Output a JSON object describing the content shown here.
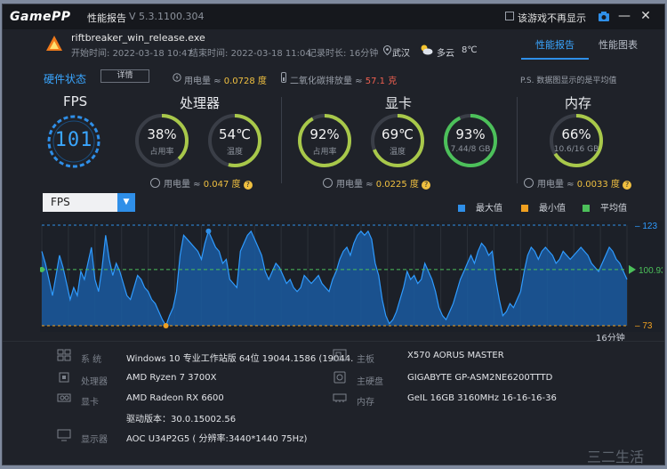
{
  "app": {
    "logo": "GamePP",
    "title": "性能报告",
    "version": "V 5.3.1100.304"
  },
  "titlebar": {
    "checkbox_label": "该游戏不再显示",
    "camera_icon": "camera-icon",
    "minimize": "—",
    "close": "✕"
  },
  "game": {
    "name": "riftbreaker_win_release.exe",
    "start_label": "开始时间:",
    "start_time": "2022-03-18 10:47",
    "end_label": "结束时间:",
    "end_time": "2022-03-18 11:04",
    "duration_label": "记录时长:",
    "duration": "16分钟",
    "city": "武汉",
    "weather": "多云",
    "temperature": "8℃"
  },
  "tabs": [
    {
      "label": "性能报告",
      "active": true
    },
    {
      "label": "性能图表",
      "active": false
    }
  ],
  "summary": {
    "hw_status": "硬件状态",
    "detail_btn": "详情",
    "power_label": "用电量 ≈",
    "power_value": "0.0728 度",
    "co2_label": "二氧化碳排放量 ≈",
    "co2_value": "57.1 克",
    "note": "P.S. 数据图显示的是平均值"
  },
  "sections": {
    "fps": "FPS",
    "cpu": "处理器",
    "gpu": "显卡",
    "mem": "内存"
  },
  "gauges": {
    "fps": {
      "value": "101"
    },
    "cpu_usage": {
      "value": "38%",
      "label": "占用率",
      "fraction": 0.38,
      "color": "#a8c84a"
    },
    "cpu_temp": {
      "value": "54℃",
      "label": "温度",
      "fraction": 0.54,
      "color": "#a8c84a"
    },
    "gpu_usage": {
      "value": "92%",
      "label": "占用率",
      "fraction": 0.92,
      "color": "#a8c84a"
    },
    "gpu_temp": {
      "value": "69℃",
      "label": "温度",
      "fraction": 0.69,
      "color": "#a8c84a"
    },
    "gpu_mem": {
      "value": "93%",
      "label": "7.44/8 GB",
      "fraction": 0.93,
      "color": "#4cc05a"
    },
    "mem": {
      "value": "66%",
      "label": "10.6/16 GB",
      "fraction": 0.66,
      "color": "#a8c84a"
    }
  },
  "power": {
    "label": "用电量 ≈",
    "cpu": "0.047 度",
    "gpu": "0.0225 度",
    "mem": "0.0033 度"
  },
  "chart_controls": {
    "select_value": "FPS",
    "legend": [
      {
        "name": "最大值",
        "color": "#2f8fe8"
      },
      {
        "name": "最小值",
        "color": "#f0a020"
      },
      {
        "name": "平均值",
        "color": "#4cc05a"
      }
    ]
  },
  "chart_data": {
    "type": "area",
    "x_label": "16分钟",
    "y_max_label": "123",
    "y_min_label": "73",
    "avg_label": "100.93",
    "ylim": [
      73,
      123
    ],
    "max": 123,
    "min": 73,
    "avg": 100.93,
    "values": [
      110,
      104,
      96,
      88,
      98,
      108,
      102,
      94,
      86,
      92,
      88,
      100,
      96,
      104,
      112,
      96,
      90,
      102,
      118,
      106,
      98,
      104,
      100,
      94,
      88,
      86,
      92,
      98,
      96,
      92,
      90,
      86,
      84,
      80,
      76,
      73,
      78,
      82,
      90,
      108,
      118,
      116,
      114,
      112,
      110,
      106,
      114,
      120,
      116,
      112,
      110,
      104,
      106,
      96,
      94,
      92,
      110,
      114,
      118,
      120,
      116,
      112,
      108,
      100,
      96,
      100,
      104,
      102,
      98,
      94,
      96,
      92,
      90,
      92,
      98,
      96,
      94,
      96,
      98,
      94,
      92,
      90,
      96,
      100,
      106,
      110,
      112,
      108,
      114,
      118,
      120,
      118,
      120,
      116,
      104,
      98,
      86,
      78,
      74,
      76,
      80,
      86,
      92,
      100,
      96,
      98,
      94,
      96,
      104,
      100,
      96,
      90,
      82,
      78,
      76,
      80,
      84,
      90,
      96,
      100,
      104,
      108,
      104,
      110,
      114,
      112,
      108,
      110,
      96,
      86,
      78,
      80,
      84,
      82,
      86,
      90,
      100,
      108,
      112,
      110,
      106,
      110,
      112,
      110,
      108,
      104,
      106,
      110,
      108,
      106,
      108,
      110,
      112,
      110,
      108,
      104,
      102,
      100,
      104,
      108,
      112,
      110,
      106,
      104,
      100,
      96
    ]
  },
  "specs": {
    "os_key": "系 统",
    "os_val": "Windows 10 专业工作站版 64位   19044.1586 (19044.",
    "cpu_key": "处理器",
    "cpu_val": "AMD Ryzen 7 3700X",
    "gpu_key": "显卡",
    "gpu_val": "AMD Radeon RX 6600",
    "driver_val": "驱动版本：30.0.15002.56",
    "monitor_key": "显示器",
    "monitor_val": "AOC U34P2G5 ( 分辨率:3440*1440 75Hz)",
    "mb_key": "主板",
    "mb_val": "X570 AORUS MASTER",
    "disk_key": "主硬盘",
    "disk_val": "GIGABYTE GP-ASM2NE6200TTTD",
    "ram_key": "内存",
    "ram_val": "GeIL 16GB 3160MHz 16-16-16-36"
  },
  "watermark": "三二生活"
}
